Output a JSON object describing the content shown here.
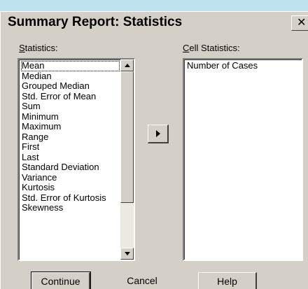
{
  "dialog": {
    "title": "Summary Report: Statistics",
    "close_glyph": "✕"
  },
  "statistics": {
    "label_mnemonic": "S",
    "label_rest": "tatistics:",
    "items": [
      "Mean",
      "Median",
      "Grouped Median",
      "Std. Error of Mean",
      "Sum",
      "Minimum",
      "Maximum",
      "Range",
      "First",
      "Last",
      "Standard Deviation",
      "Variance",
      "Kurtosis",
      "Std. Error of Kurtosis",
      "Skewness"
    ],
    "selected": "Mean"
  },
  "cell_statistics": {
    "label_mnemonic": "C",
    "label_rest": "ell Statistics:",
    "items": [
      "Number of Cases"
    ]
  },
  "buttons": {
    "continue": "Continue",
    "cancel": "Cancel",
    "help": "Help"
  },
  "icons": {
    "move": "right-arrow-icon",
    "close": "close-icon",
    "scroll_up": "scroll-up-arrow-icon",
    "scroll_down": "scroll-down-arrow-icon"
  },
  "colors": {
    "dialog_bg": "#d4d0c8",
    "list_bg": "#ffffff",
    "desktop_bg": "#bfe3ef"
  }
}
